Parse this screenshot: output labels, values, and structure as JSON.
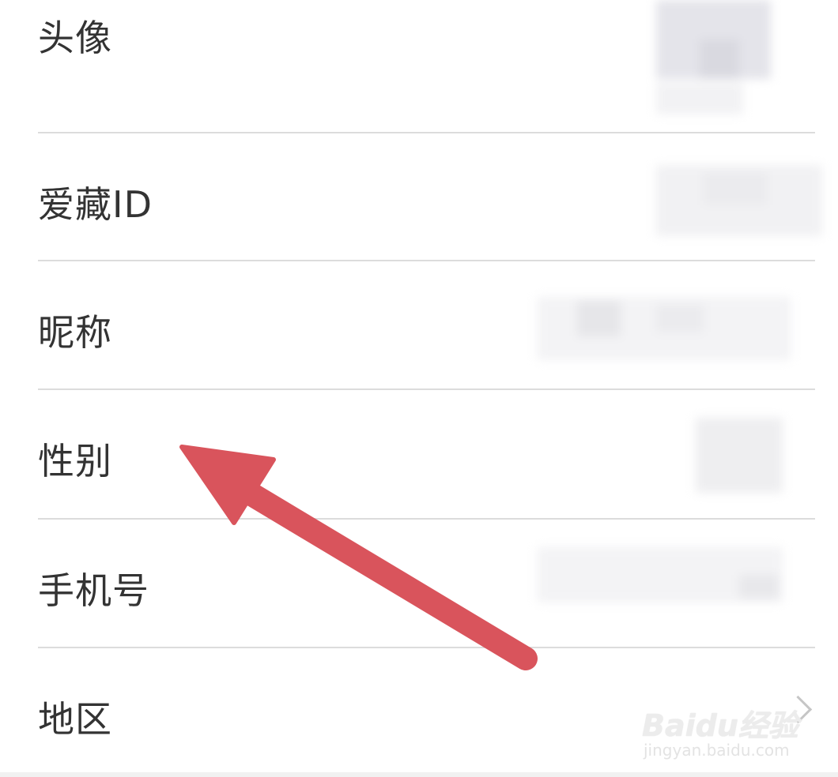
{
  "profile_fields": [
    {
      "key": "avatar",
      "label": "头像"
    },
    {
      "key": "aicang_id",
      "label": "爱藏ID"
    },
    {
      "key": "nickname",
      "label": "昵称"
    },
    {
      "key": "gender",
      "label": "性别"
    },
    {
      "key": "phone",
      "label": "手机号"
    },
    {
      "key": "region",
      "label": "地区"
    }
  ],
  "annotation": {
    "arrow_icon": "arrow-pointing-to-gender",
    "arrow_color": "#d9545c"
  },
  "watermark": {
    "brand": "Baidu",
    "brand_cn": "经验",
    "url": "jingyan.baidu.com"
  },
  "colors": {
    "label_text": "#333333",
    "divider": "#dcdcdc",
    "background": "#ffffff"
  },
  "icons": {
    "region_chevron": "chevron-right-icon"
  }
}
